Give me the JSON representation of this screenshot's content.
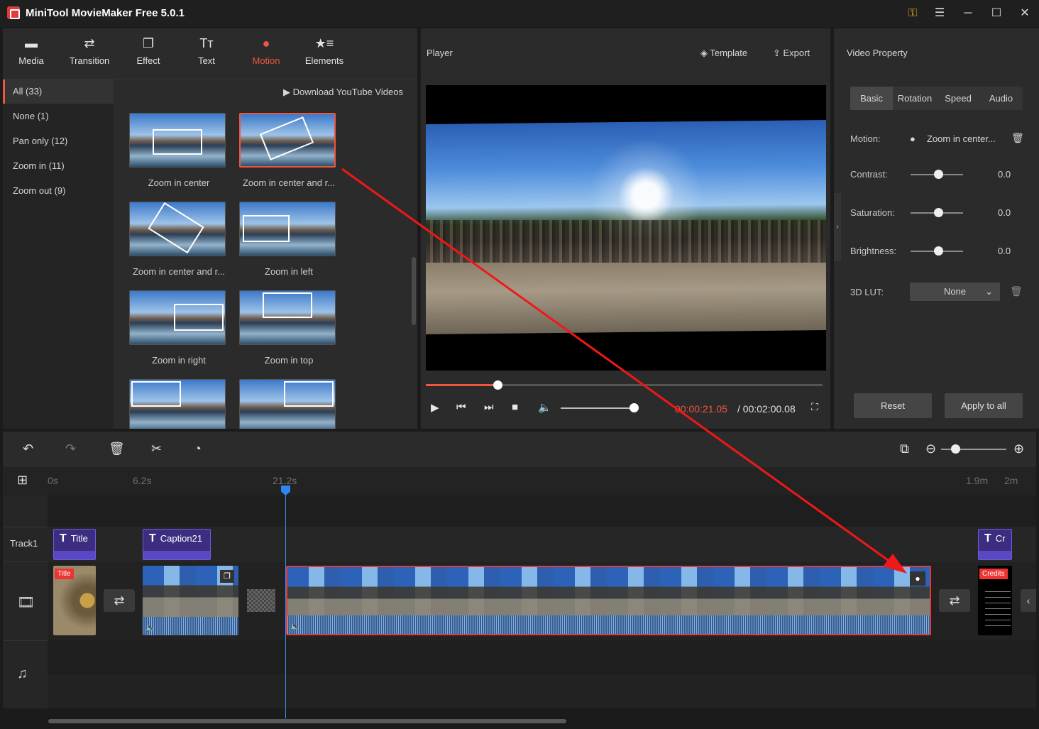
{
  "app": {
    "title": "MiniTool MovieMaker Free 5.0.1"
  },
  "toolbar": {
    "items": [
      {
        "label": "Media",
        "icon": "folder-icon"
      },
      {
        "label": "Transition",
        "icon": "swap-icon"
      },
      {
        "label": "Effect",
        "icon": "layers-icon"
      },
      {
        "label": "Text",
        "icon": "text-icon"
      },
      {
        "label": "Motion",
        "icon": "motion-icon"
      },
      {
        "label": "Elements",
        "icon": "elements-icon"
      }
    ],
    "active": "Motion"
  },
  "categories": {
    "items": [
      "All (33)",
      "None (1)",
      "Pan only (12)",
      "Zoom in (11)",
      "Zoom out (9)"
    ],
    "active": "All (33)"
  },
  "grid": {
    "download_link": "Download YouTube Videos",
    "thumbs": [
      {
        "label": "Zoom in center"
      },
      {
        "label": "Zoom in center and r..."
      },
      {
        "label": "Zoom in center and r..."
      },
      {
        "label": "Zoom in left"
      },
      {
        "label": "Zoom in right"
      },
      {
        "label": "Zoom in top"
      },
      {
        "label": ""
      },
      {
        "label": ""
      }
    ]
  },
  "player": {
    "title": "Player",
    "template_label": "Template",
    "export_label": "Export",
    "time_current": "00:00:21.05",
    "time_total": "/ 00:02:00.08",
    "progress": 0.18,
    "volume": 1.0
  },
  "property": {
    "title": "Video Property",
    "tabs": [
      "Basic",
      "Rotation",
      "Speed",
      "Audio"
    ],
    "active_tab": "Basic",
    "motion_label": "Motion:",
    "motion_value": "Zoom in center...",
    "contrast_label": "Contrast:",
    "contrast_value": "0.0",
    "saturation_label": "Saturation:",
    "saturation_value": "0.0",
    "brightness_label": "Brightness:",
    "brightness_value": "0.0",
    "lut_label": "3D LUT:",
    "lut_value": "None",
    "reset_label": "Reset",
    "apply_label": "Apply to all"
  },
  "timeline": {
    "ruler": [
      "0s",
      "6.2s",
      "21.2s",
      "1.9m",
      "2m"
    ],
    "track1_label": "Track1",
    "text_clips": [
      {
        "label": "Title"
      },
      {
        "label": "Caption21"
      },
      {
        "label": "Cr"
      }
    ],
    "video_badges": {
      "title": "Title",
      "credits": "Credits"
    }
  },
  "colors": {
    "accent": "#f0553f",
    "playhead": "#2f86f2",
    "text_clip": "#3c2d80"
  }
}
